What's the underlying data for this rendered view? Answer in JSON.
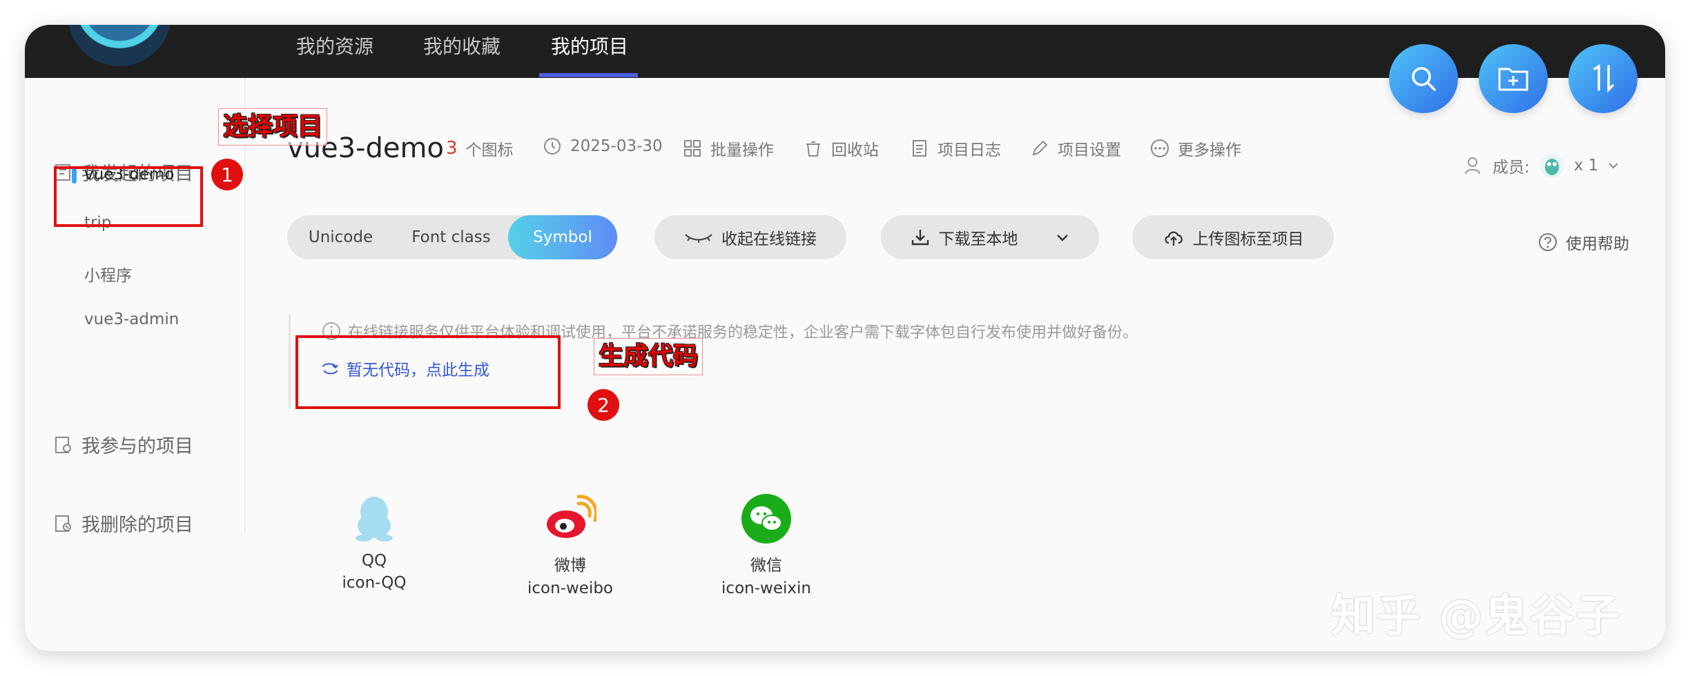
{
  "nav": {
    "items": [
      "我的资源",
      "我的收藏",
      "我的项目"
    ],
    "active_index": 2
  },
  "sidebar": {
    "groups": {
      "initiated": "我发起的项目",
      "participated": "我参与的项目",
      "deleted": "我删除的项目"
    },
    "projects": [
      "vue3-demo",
      "trip",
      "小程序",
      "vue3-admin"
    ],
    "selected": "vue3-demo"
  },
  "project": {
    "name": "vue3-demo",
    "icon_count": "3",
    "icon_count_unit": "个图标",
    "date": "2025-03-30",
    "actions": [
      "批量操作",
      "回收站",
      "项目日志",
      "项目设置",
      "更多操作"
    ]
  },
  "members": {
    "label": "成员:",
    "count": "x 1"
  },
  "format_tabs": [
    "Unicode",
    "Font class",
    "Symbol"
  ],
  "active_format": "Symbol",
  "buttons": {
    "collapse_link": "收起在线链接",
    "download": "下载至本地",
    "upload": "上传图标至项目",
    "help": "使用帮助"
  },
  "notice": "在线链接服务仅供平台体验和调试使用，平台不承诺服务的稳定性，企业客户需下载字体包自行发布使用并做好备份。",
  "generate_link": "暂无代码，点此生成",
  "icons": [
    {
      "name": "QQ",
      "code": "icon-QQ",
      "icon": "qq-icon"
    },
    {
      "name": "微博",
      "code": "icon-weibo",
      "icon": "weibo-icon"
    },
    {
      "name": "微信",
      "code": "icon-weixin",
      "icon": "wechat-icon"
    }
  ],
  "annotations": {
    "step1": "1",
    "step1_label": "选择项目",
    "step2": "2",
    "step2_label": "生成代码"
  },
  "watermark": "知乎 @鬼谷子",
  "colors": {
    "accent": "#4b5fe0",
    "annotation_red": "#e01010",
    "link_blue": "#3357d6",
    "count_red": "#d93b2b"
  }
}
